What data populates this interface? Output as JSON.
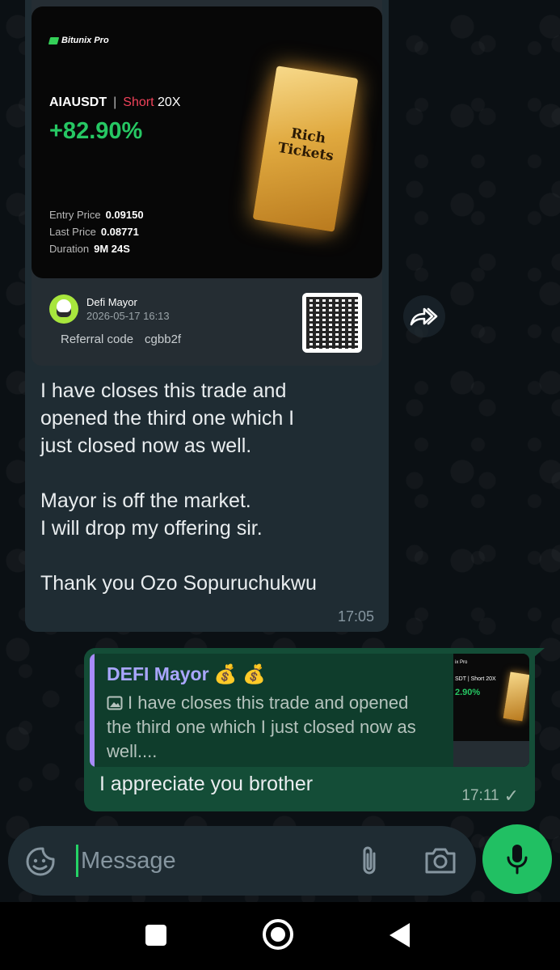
{
  "incoming": {
    "card": {
      "brand": "Bitunix Pro",
      "pair": "AIAUSDT",
      "separator": "|",
      "side": "Short",
      "leverage": "20X",
      "pnl": "+82.90%",
      "entry_label": "Entry Price",
      "entry_value": "0.09150",
      "last_label": "Last Price",
      "last_value": "0.08771",
      "duration_label": "Duration",
      "duration_value": "9M 24S",
      "ticket_text": "Rich Tickets",
      "user_name": "Defi Mayor",
      "user_date": "2026-05-17 16:13",
      "referral_label": "Referral code",
      "referral_code": "cgbb2f"
    },
    "text": "I have closes this trade and\nopened the third one which I\njust closed now as well.\n\nMayor is off the market.\nI will drop my offering sir.\n\nThank you Ozo Sopuruchukwu",
    "time": "17:05"
  },
  "outgoing": {
    "quote_author": "DEFI Mayor 💰 💰",
    "quote_text": "I have closes this trade and opened the third one which I just closed now as well....",
    "thumb_brand": "ix Pro",
    "thumb_pair": "SDT | Short 20X",
    "thumb_pnl": "2.90%",
    "text": "I appreciate you brother",
    "time": "17:11",
    "status_icon": "✓"
  },
  "composer": {
    "placeholder": "Message"
  },
  "colors": {
    "accent": "#21c063",
    "outgoing_bubble": "#144d37",
    "incoming_bubble": "#1f2c33",
    "pnl_green": "#26c763",
    "short_red": "#f0425a"
  }
}
